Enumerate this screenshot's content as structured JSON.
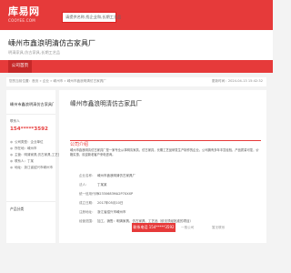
{
  "site": {
    "logo_main": "库易网",
    "logo_sub": "COOYEE.COM",
    "search_placeholder": "请提供名称,找企业和,长期工艺品"
  },
  "header": {
    "company": "嵊州市鑫浪明清仿古家具厂",
    "tagline": "明清家具,仿古家具,长期工艺品"
  },
  "nav": {
    "tab": "公司首页"
  },
  "breadcrumb": {
    "path": "您的当前位置：首页 » 企业 » 嵊州市 » 嵊州市鑫浪明清仿古家具厂",
    "date": "更新时间：2024-04-13 15:42:32"
  },
  "sidebar": {
    "name": "嵊州市鑫浪明清仿古家具厂",
    "phone": "154*****3592",
    "label_contact": "联系人",
    "rows": [
      "公司类型：企业单位",
      "所在地：嵊州市",
      "主营：明清家具,仿古家具,工艺品",
      "联系人：丁某",
      "地址：浙江省绍兴市嵊州市"
    ],
    "products": "产品分类"
  },
  "main": {
    "title": "嵊州市鑫浪明清仿古家具厂",
    "section": "公司介绍",
    "intro": "嵊州市鑫浪明清仿古家具厂是一家专业从事明清家具，仿古家具，长期工艺品研发生产制作的企业。公司拥有多年丰富经验，产品质量可靠，价格实惠，欢迎新老客户来电咨询。",
    "fields": [
      {
        "k": "企业名称：",
        "v": "嵊州市鑫浪明清仿古家具厂"
      },
      {
        "k": "法人：",
        "v": "丁某某"
      },
      {
        "k": "统一信用代码：",
        "v": "92330683MA2P7XXXP"
      },
      {
        "k": "成立日期：",
        "v": "2017年05月10日"
      },
      {
        "k": "注册地址：",
        "v": "浙江省绍兴市嵊州市"
      },
      {
        "k": "经营范围：",
        "v": "加工、销售：明清家具、仿古家具、工艺品（依法须经批准的项目）"
      }
    ],
    "btn_phone": "联系电话 154*****3592",
    "lbl_a": "一般公司",
    "lbl_b": "暂无联系"
  }
}
